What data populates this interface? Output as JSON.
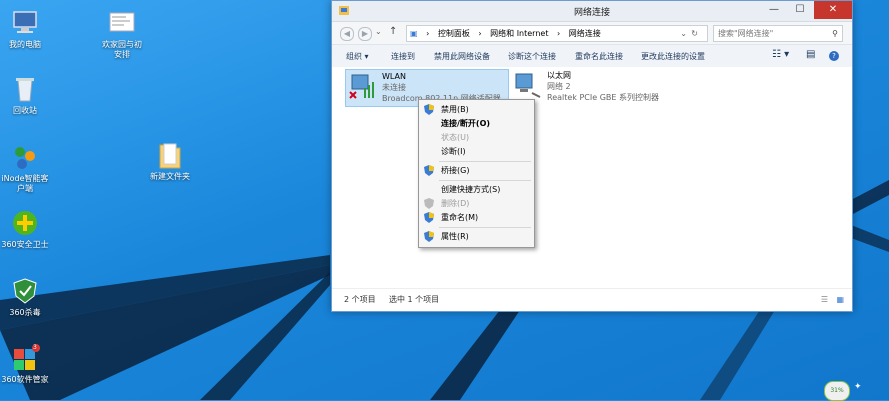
{
  "desktop": {
    "icons": [
      {
        "label": "我的电脑",
        "icon": "computer-icon"
      },
      {
        "label": "回收站",
        "icon": "recycle-bin-icon"
      },
      {
        "label": "iNode智能客户端",
        "icon": "inode-icon"
      },
      {
        "label": "360安全卫士",
        "icon": "360-safe-icon"
      },
      {
        "label": "360杀毒",
        "icon": "360-antivirus-icon"
      },
      {
        "label": "360软件管家",
        "icon": "360-software-icon"
      },
      {
        "label": "欢家园与初安排",
        "icon": "document-icon"
      },
      {
        "label": "新建文件夹",
        "icon": "folder-icon"
      }
    ],
    "software_badge": "3"
  },
  "window": {
    "title": "网络连接",
    "controls": {
      "minimize": "—",
      "maximize": "☐",
      "close": "✕"
    },
    "breadcrumbs": [
      "控制面板",
      "›",
      "网络和 Internet",
      "›",
      "网络连接"
    ],
    "search_placeholder": "搜索\"网络连接\"",
    "toolbar": {
      "organize": "组织 ▾",
      "connect": "连接到",
      "disable": "禁用此网络设备",
      "diagnose": "诊断这个连接",
      "rename": "重命名此连接",
      "change": "更改此连接的设置"
    },
    "items": [
      {
        "name": "WLAN",
        "status": "未连接",
        "adapter": "Broadcom 802.11n 网络适配器"
      },
      {
        "name": "以太网",
        "status": "网络 2",
        "adapter": "Realtek PCIe GBE 系列控制器"
      }
    ],
    "status": {
      "count": "2 个项目",
      "selected": "选中 1 个项目"
    }
  },
  "context_menu": {
    "items": [
      {
        "label": "禁用(B)",
        "shield": true,
        "disabled": false,
        "bold": false
      },
      {
        "label": "连接/断开(O)",
        "shield": false,
        "disabled": false,
        "bold": true
      },
      {
        "label": "状态(U)",
        "shield": false,
        "disabled": true,
        "bold": false
      },
      {
        "label": "诊断(I)",
        "shield": false,
        "disabled": false,
        "bold": false
      },
      {
        "label": "桥接(G)",
        "shield": true,
        "disabled": false,
        "bold": false
      },
      {
        "label": "创建快捷方式(S)",
        "shield": false,
        "disabled": false,
        "bold": false
      },
      {
        "label": "删除(D)",
        "shield": true,
        "disabled": true,
        "bold": false
      },
      {
        "label": "重命名(M)",
        "shield": true,
        "disabled": false,
        "bold": false
      },
      {
        "label": "属性(R)",
        "shield": true,
        "disabled": false,
        "bold": false
      }
    ]
  },
  "taskbar": {
    "battery": "31%"
  },
  "colors": {
    "close": "#c7362c",
    "selection": "#cce4f7",
    "desktop": "#1e8fe0"
  }
}
